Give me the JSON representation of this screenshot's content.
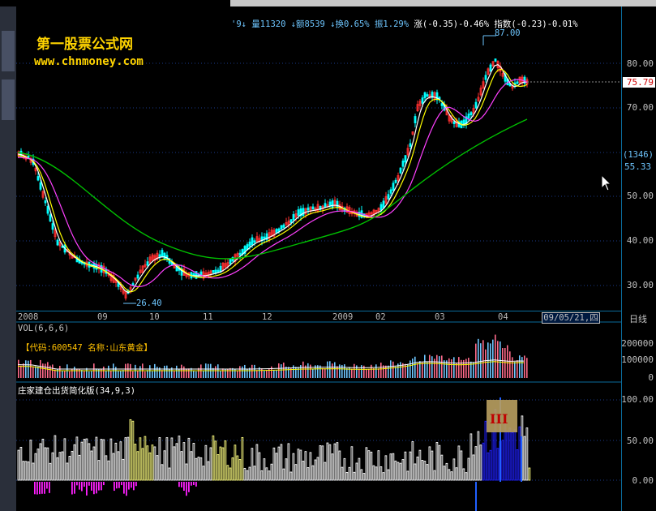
{
  "logo": {
    "title": "第一股票公式网",
    "url": "www.chnmoney.com"
  },
  "stat_line": {
    "prefix": "'9↓",
    "vol": "量11320",
    "amount": "↓额8539",
    "turnover": "↓换0.65%",
    "amplitude": "振1.29%",
    "change": "涨(-0.35)-0.46%",
    "index": "指数(-0.23)-0.01%"
  },
  "labels": {
    "peak": "87.00",
    "low": "26.40",
    "current_price": "75.79",
    "count_box": "(1346)",
    "count_value": "55.33",
    "date_box": "09/05/21,四",
    "day_label": "日线"
  },
  "price_axis": [
    "80.00",
    "70.00",
    "50.00",
    "40.00",
    "30.00"
  ],
  "x_axis": [
    "2008",
    "09",
    "10",
    "11",
    "12",
    "2009",
    "02",
    "03",
    "04"
  ],
  "volume": {
    "title": "VOL(6,6,6)",
    "info": "【代码:600547 名称:山东黄金】",
    "axis": [
      "200000",
      "100000",
      "0"
    ]
  },
  "indicator": {
    "title": "庄家建仓出货简化版(34,9,3)",
    "axis": [
      "100.00",
      "50.00",
      "0.00"
    ],
    "overlay_text": "III"
  },
  "colors": {
    "up": "#ff3030",
    "down": "#00ffff",
    "ma_short": "#ffffff",
    "ma_yellow": "#ffff00",
    "ma_magenta": "#ff40ff",
    "ma_green": "#00c000",
    "grid": "#1a3a8a",
    "volume_bar": "#6ec6ff"
  },
  "icons": [
    "cursor-arrow-icon",
    "scroll-up-icon",
    "close-icon"
  ]
}
